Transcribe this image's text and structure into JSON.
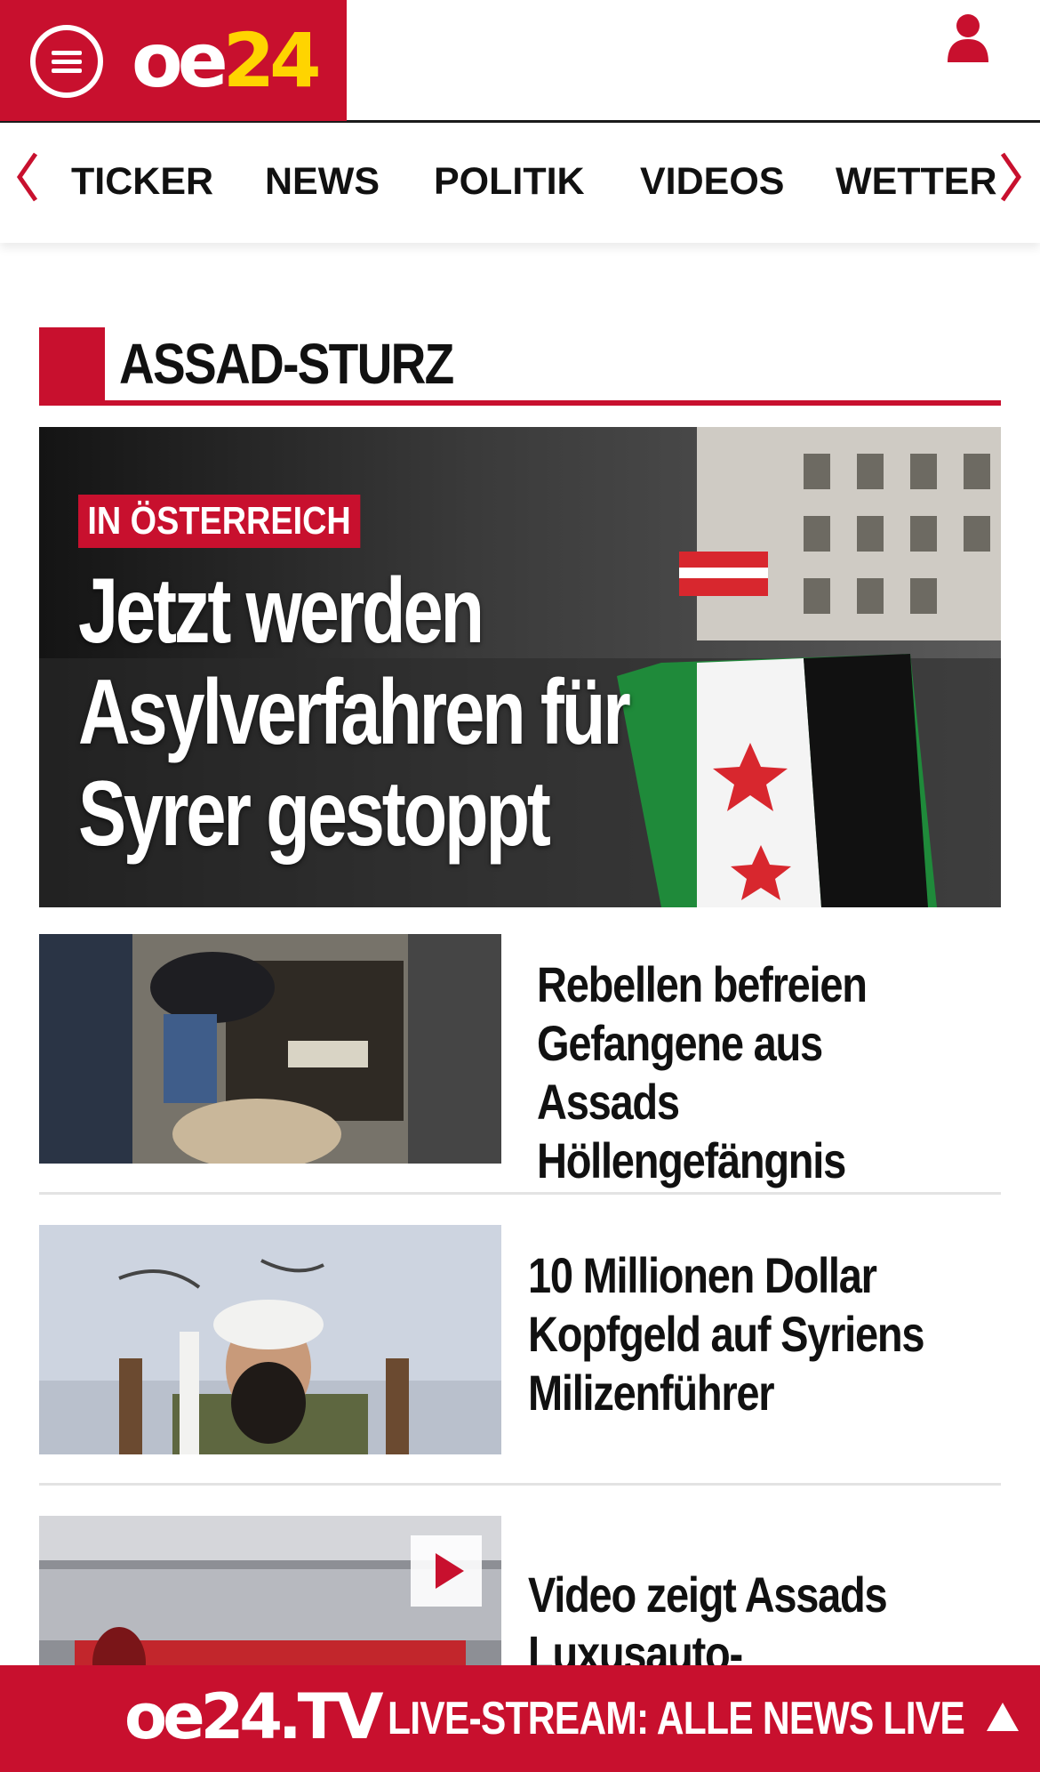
{
  "header": {
    "logo_oe": "oe",
    "logo_num": "24"
  },
  "nav": {
    "items": [
      {
        "label": "TICKER"
      },
      {
        "label": "NEWS"
      },
      {
        "label": "POLITIK"
      },
      {
        "label": "VIDEOS"
      },
      {
        "label": "WETTER"
      }
    ]
  },
  "section": {
    "title": "ASSAD-STURZ"
  },
  "hero": {
    "kicker": "IN ÖSTERREICH",
    "title": "Jetzt werden Asylverfahren für Syrer gestoppt"
  },
  "articles": [
    {
      "headline": "Rebellen befreien Gefangene aus Assads Höllengefängnis"
    },
    {
      "headline": "10 Millionen Dollar Kopfgeld auf Syriens Milizenführer"
    },
    {
      "headline": "Video zeigt Assads Luxusauto-Sammlung"
    }
  ],
  "footer": {
    "tv_logo": "oe24.TV",
    "live_text": "LIVE-STREAM:  ALLE NEWS LIVE"
  },
  "colors": {
    "brand_red": "#c8102e",
    "logo_yellow": "#ffd400"
  },
  "icons": [
    "menu-icon",
    "user-icon",
    "chevron-left-icon",
    "chevron-right-icon",
    "play-icon",
    "arrow-up-icon"
  ]
}
